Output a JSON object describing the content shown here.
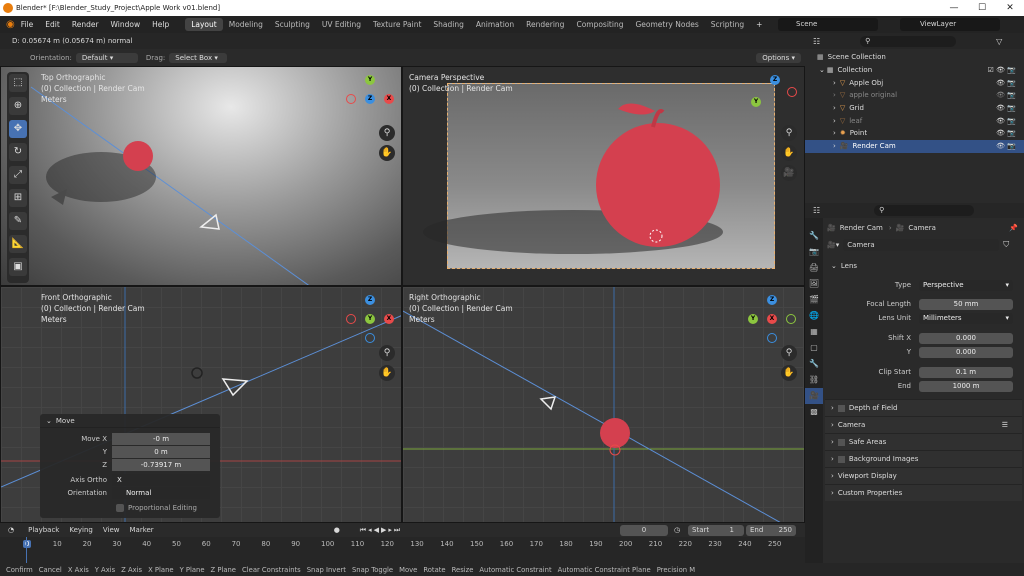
{
  "title": {
    "text": "Blender* [F:\\Blender_Study_Project\\Apple Work v01.blend]",
    "min": "—",
    "max": "☐",
    "close": "✕"
  },
  "menu": {
    "items": [
      "File",
      "Edit",
      "Render",
      "Window",
      "Help"
    ]
  },
  "workspaces": [
    "Layout",
    "Modeling",
    "Sculpting",
    "UV Editing",
    "Texture Paint",
    "Shading",
    "Animation",
    "Rendering",
    "Compositing",
    "Geometry Nodes",
    "Scripting"
  ],
  "scene": {
    "name": "Scene",
    "viewlayer": "ViewLayer"
  },
  "header": {
    "status": "D: 0.05674 m (0.05674 m) normal",
    "orientation_label": "Orientation:",
    "orientation_value": "Default",
    "drag_label": "Drag:",
    "drag_value": "Select Box",
    "options": "Options"
  },
  "viewports": {
    "top": {
      "name": "Top Orthographic",
      "coll": "(0) Collection | Render Cam",
      "units": "Meters"
    },
    "cam": {
      "name": "Camera Perspective",
      "coll": "(0) Collection | Render Cam"
    },
    "front": {
      "name": "Front Orthographic",
      "coll": "(0) Collection | Render Cam",
      "units": "Meters"
    },
    "right": {
      "name": "Right Orthographic",
      "coll": "(0) Collection | Render Cam",
      "units": "Meters"
    }
  },
  "gizmo": {
    "x": "X",
    "y": "Y",
    "z": "Z"
  },
  "move_panel": {
    "title": "Move",
    "move_x_label": "Move X",
    "move_x": "-0 m",
    "y_label": "Y",
    "y": "0 m",
    "z_label": "Z",
    "z": "-0.73917 m",
    "axis_ortho_label": "Axis Ortho",
    "axis_ortho": "X",
    "orientation_label": "Orientation",
    "orientation": "Normal",
    "proportional": "Proportional Editing"
  },
  "outliner": {
    "scene_collection": "Scene Collection",
    "collection": "Collection",
    "items": [
      "Apple Obj",
      "apple original",
      "Grid",
      "leaf",
      "Point",
      "Render Cam"
    ]
  },
  "properties": {
    "object": "Render Cam",
    "data": "Camera",
    "camera_name": "Camera",
    "lens_section": "Lens",
    "type_label": "Type",
    "type": "Perspective",
    "focal_label": "Focal Length",
    "focal": "50 mm",
    "lens_unit_label": "Lens Unit",
    "lens_unit": "Millimeters",
    "shift_x_label": "Shift X",
    "shift_x": "0.000",
    "shift_y_label": "Y",
    "shift_y": "0.000",
    "clip_start_label": "Clip Start",
    "clip_start": "0.1 m",
    "clip_end_label": "End",
    "clip_end": "1000 m",
    "panels": [
      "Depth of Field",
      "Camera",
      "Safe Areas",
      "Background Images",
      "Viewport Display",
      "Custom Properties"
    ]
  },
  "timeline": {
    "playback": "Playback",
    "keying": "Keying",
    "view": "View",
    "marker": "Marker",
    "current": "0",
    "start_label": "Start",
    "start": "1",
    "end_label": "End",
    "end": "250",
    "ticks": [
      "0",
      "10",
      "20",
      "30",
      "40",
      "50",
      "60",
      "70",
      "80",
      "90",
      "100",
      "110",
      "120",
      "130",
      "140",
      "150",
      "160",
      "170",
      "180",
      "190",
      "200",
      "210",
      "220",
      "230",
      "240",
      "250"
    ]
  },
  "statusbar": [
    "Confirm",
    "Cancel",
    "X Axis",
    "Y Axis",
    "Z Axis",
    "X Plane",
    "Y Plane",
    "Z Plane",
    "Clear Constraints",
    "Snap Invert",
    "Snap Toggle",
    "Move",
    "Rotate",
    "Resize",
    "Automatic Constraint",
    "Automatic Constraint Plane",
    "Precision M"
  ],
  "colors": {
    "accent": "#4772b3",
    "apple": "#d4404f",
    "x_axis": "#e84a4a",
    "y_axis": "#8cc63f",
    "z_axis": "#3b8fe0",
    "selected_row": "#335186"
  }
}
